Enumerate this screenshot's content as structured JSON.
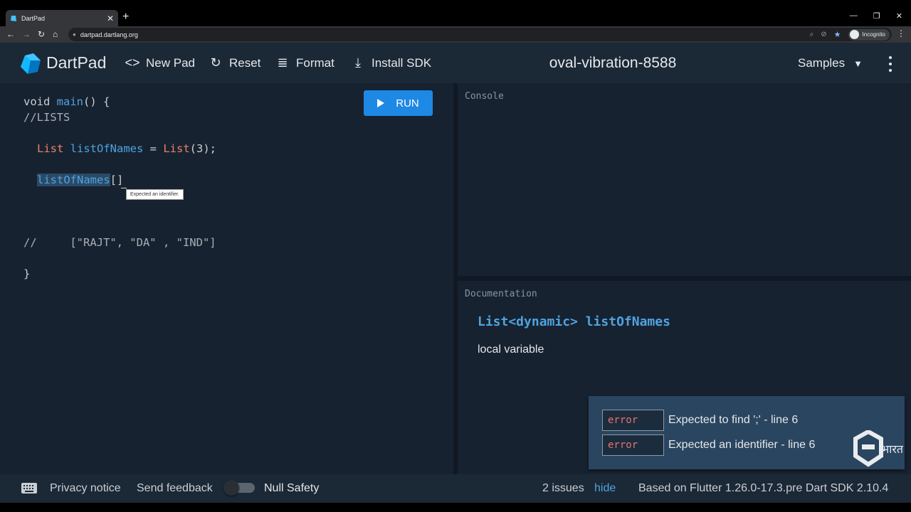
{
  "browser": {
    "tab_title": "DartPad",
    "tab_close": "✕",
    "new_tab": "+",
    "window_controls": [
      "—",
      "❐",
      "✕"
    ],
    "url": "dartpad.dartlang.org",
    "incognito_label": "Incognito"
  },
  "header": {
    "brand": "DartPad",
    "buttons": [
      {
        "label": "New Pad",
        "icon": "code-icon"
      },
      {
        "label": "Reset",
        "icon": "refresh-icon"
      },
      {
        "label": "Format",
        "icon": "format-align-icon"
      },
      {
        "label": "Install SDK",
        "icon": "download-icon"
      }
    ],
    "pad_name": "oval-vibration-8588",
    "samples_label": "Samples"
  },
  "editor": {
    "lines": {
      "l1_kw": "void ",
      "l1_fn": "main",
      "l1_rest": "() {",
      "l2": "//LISTS",
      "l4_ty": "List",
      "l4_var": "listOfNames",
      "l4_eq": " = ",
      "l4_ty2": "List",
      "l4_args": "(3);",
      "l6_sel": "listOfNames",
      "l6_rest": "[]",
      "l9": "//     [\"RAJT\", \"DA\" , \"IND\"]",
      "l11": "}"
    },
    "tooltip": "Expected an identifier.",
    "run_label": "RUN"
  },
  "console": {
    "header": "Console"
  },
  "documentation": {
    "header": "Documentation",
    "signature": "List<dynamic> listOfNames",
    "description": "local variable"
  },
  "issues": [
    {
      "tag": "error",
      "message": "Expected to find ';' - line 6"
    },
    {
      "tag": "error",
      "message": "Expected an identifier - line 6"
    }
  ],
  "watermark_text": "भारत",
  "footer": {
    "privacy": "Privacy notice",
    "feedback": "Send feedback",
    "null_safety": "Null Safety",
    "null_safety_enabled": false,
    "issues_count": "2 issues",
    "hide": "hide",
    "version": "Based on Flutter 1.26.0-17.3.pre Dart SDK 2.10.4"
  },
  "colors": {
    "accent": "#1e88e5",
    "background": "#172230",
    "header": "#1b2836",
    "error": "#e57373",
    "link": "#4fa3e0"
  }
}
